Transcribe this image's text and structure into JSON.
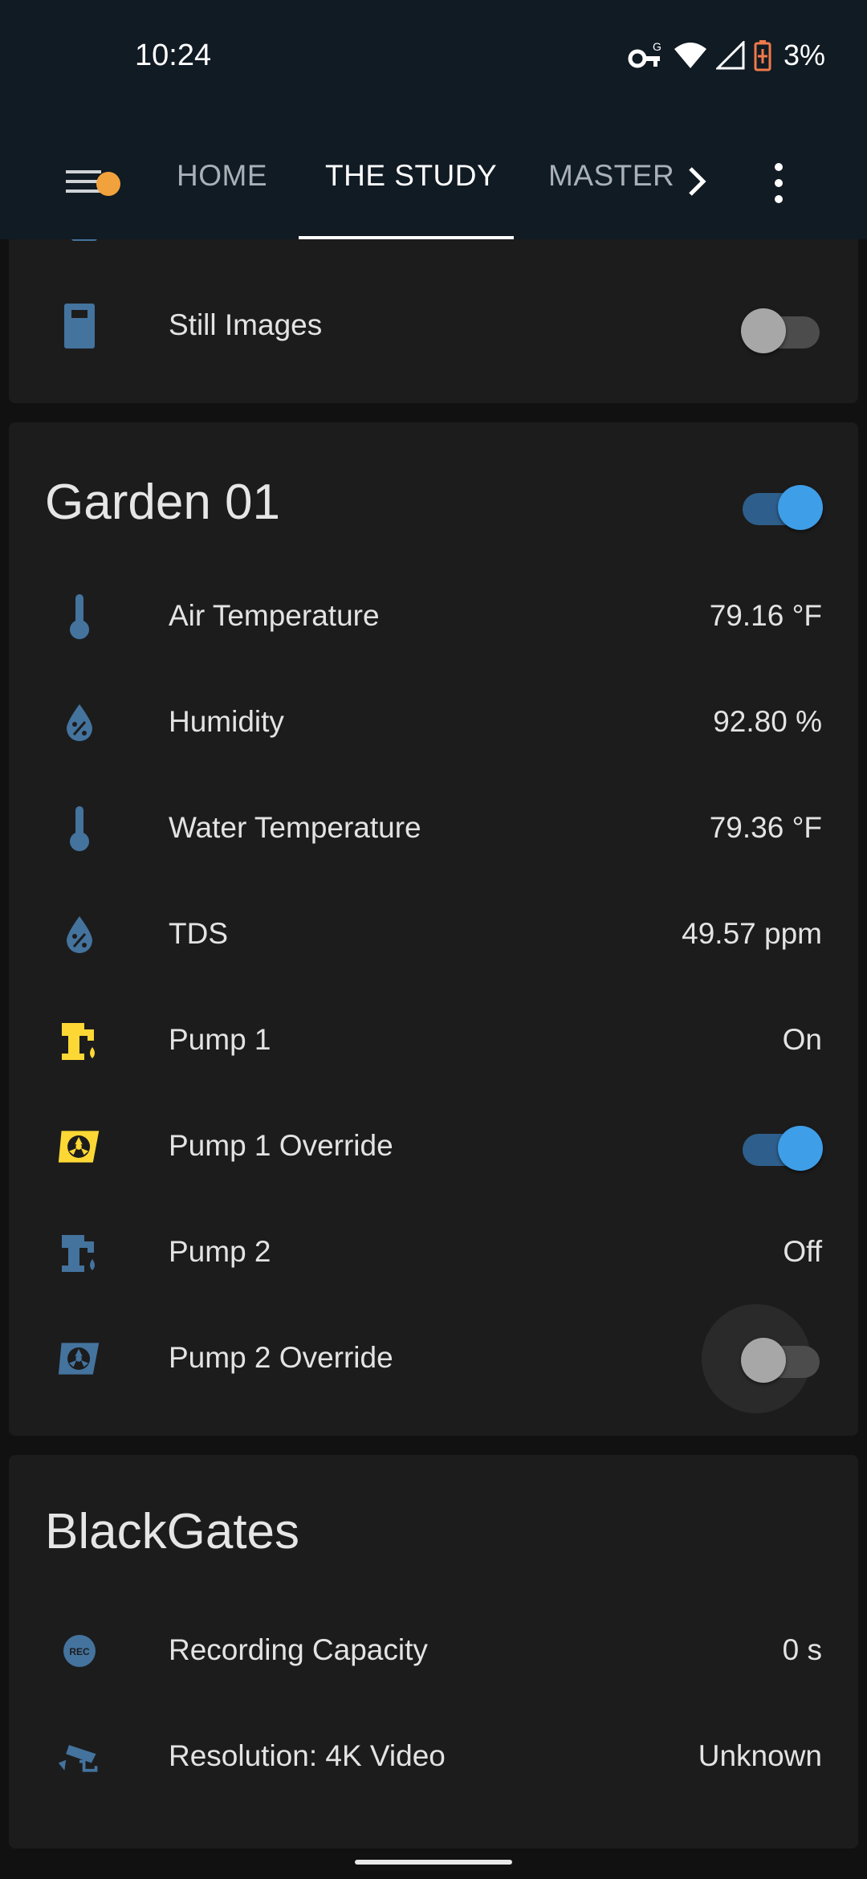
{
  "status_bar": {
    "time": "10:24",
    "battery": "3%",
    "icons": [
      "vpn-key-icon",
      "wifi-icon",
      "signal-icon",
      "battery-low-icon"
    ]
  },
  "tabs": {
    "items": [
      {
        "label": "HOME"
      },
      {
        "label": "THE STUDY"
      },
      {
        "label": "MASTER"
      }
    ],
    "active_index": 1,
    "notification_dot_color": "#f2a23c"
  },
  "cards": {
    "cameras": {
      "rows": [
        {
          "name": "Still Images",
          "icon": "camera-icon",
          "toggle": false
        }
      ]
    },
    "garden": {
      "title": "Garden 01",
      "toggle": true,
      "rows": [
        {
          "name": "Air Temperature",
          "value": "79.16 °F",
          "icon": "thermometer-icon"
        },
        {
          "name": "Humidity",
          "value": "92.80 %",
          "icon": "water-percent-icon"
        },
        {
          "name": "Water Temperature",
          "value": "79.36 °F",
          "icon": "thermometer-icon"
        },
        {
          "name": "TDS",
          "value": "49.57 ppm",
          "icon": "water-percent-icon"
        },
        {
          "name": "Pump 1",
          "value": "On",
          "icon": "water-pump-icon"
        },
        {
          "name": "Pump 1 Override",
          "icon": "fan-icon",
          "toggle": true
        },
        {
          "name": "Pump 2",
          "value": "Off",
          "icon": "water-pump-icon"
        },
        {
          "name": "Pump 2 Override",
          "icon": "fan-icon",
          "toggle": false
        }
      ]
    },
    "blackgates": {
      "title": "BlackGates",
      "rows": [
        {
          "name": "Recording Capacity",
          "value": "0 s",
          "icon": "record-rec-icon"
        },
        {
          "name": "Resolution: 4K Video",
          "value": "Unknown",
          "icon": "cctv-icon"
        }
      ]
    }
  },
  "colors": {
    "background": "#111111",
    "card": "#1c1c1c",
    "header": "#111b24",
    "icon_blue": "#44739e",
    "icon_active_yellow": "#fdd835",
    "toggle_on": "#3f9ee8"
  }
}
